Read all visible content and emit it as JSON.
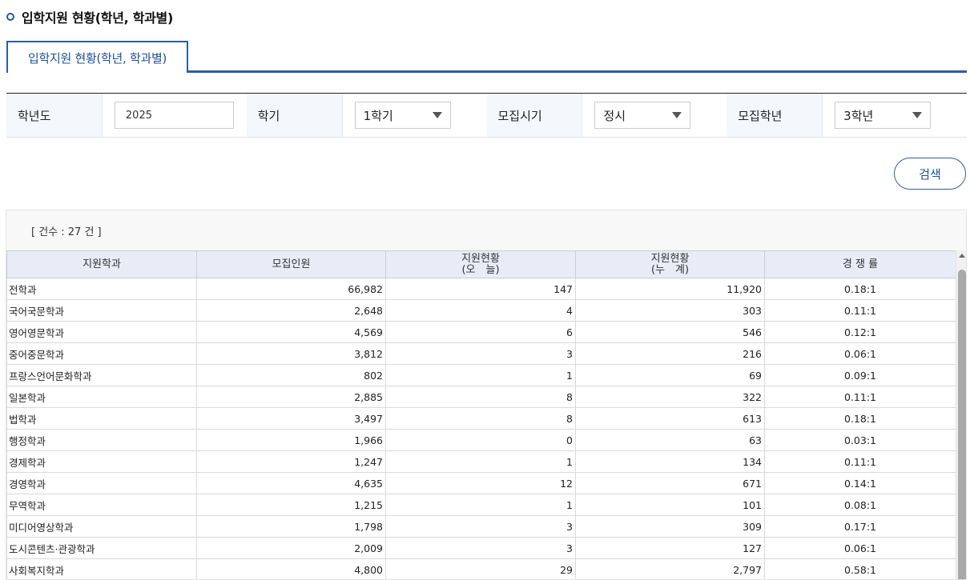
{
  "page": {
    "title": "입학지원 현황(학년, 학과별)"
  },
  "tabs": [
    {
      "label": "입학지원 현황(학년, 학과별)"
    }
  ],
  "filters": {
    "year_label": "학년도",
    "year_value": "2025",
    "semester_label": "학기",
    "semester_value": "1학기",
    "period_label": "모집시기",
    "period_value": "정시",
    "grade_label": "모집학년",
    "grade_value": "3학년"
  },
  "search": {
    "label": "검색"
  },
  "result": {
    "count_text": "[ 건수 : 27 건 ]",
    "headers": {
      "dept": "지원학과",
      "recruit": "모집인원",
      "today_line1": "지원현황",
      "today_line2": "(오　늘)",
      "total_line1": "지원현황",
      "total_line2": "(누　계)",
      "ratio": "경 쟁 률"
    },
    "rows": [
      {
        "dept": "전학과",
        "recruit": "66,982",
        "today": "147",
        "total": "11,920",
        "ratio": "0.18:1"
      },
      {
        "dept": "국어국문학과",
        "recruit": "2,648",
        "today": "4",
        "total": "303",
        "ratio": "0.11:1"
      },
      {
        "dept": "영어영문학과",
        "recruit": "4,569",
        "today": "6",
        "total": "546",
        "ratio": "0.12:1"
      },
      {
        "dept": "중어중문학과",
        "recruit": "3,812",
        "today": "3",
        "total": "216",
        "ratio": "0.06:1"
      },
      {
        "dept": "프랑스언어문화학과",
        "recruit": "802",
        "today": "1",
        "total": "69",
        "ratio": "0.09:1"
      },
      {
        "dept": "일본학과",
        "recruit": "2,885",
        "today": "8",
        "total": "322",
        "ratio": "0.11:1"
      },
      {
        "dept": "법학과",
        "recruit": "3,497",
        "today": "8",
        "total": "613",
        "ratio": "0.18:1"
      },
      {
        "dept": "행정학과",
        "recruit": "1,966",
        "today": "0",
        "total": "63",
        "ratio": "0.03:1"
      },
      {
        "dept": "경제학과",
        "recruit": "1,247",
        "today": "1",
        "total": "134",
        "ratio": "0.11:1"
      },
      {
        "dept": "경영학과",
        "recruit": "4,635",
        "today": "12",
        "total": "671",
        "ratio": "0.14:1"
      },
      {
        "dept": "무역학과",
        "recruit": "1,215",
        "today": "1",
        "total": "101",
        "ratio": "0.08:1"
      },
      {
        "dept": "미디어영상학과",
        "recruit": "1,798",
        "today": "3",
        "total": "309",
        "ratio": "0.17:1"
      },
      {
        "dept": "도시콘텐츠·관광학과",
        "recruit": "2,009",
        "today": "3",
        "total": "127",
        "ratio": "0.06:1"
      },
      {
        "dept": "사회복지학과",
        "recruit": "4,800",
        "today": "29",
        "total": "2,797",
        "ratio": "0.58:1"
      }
    ]
  }
}
